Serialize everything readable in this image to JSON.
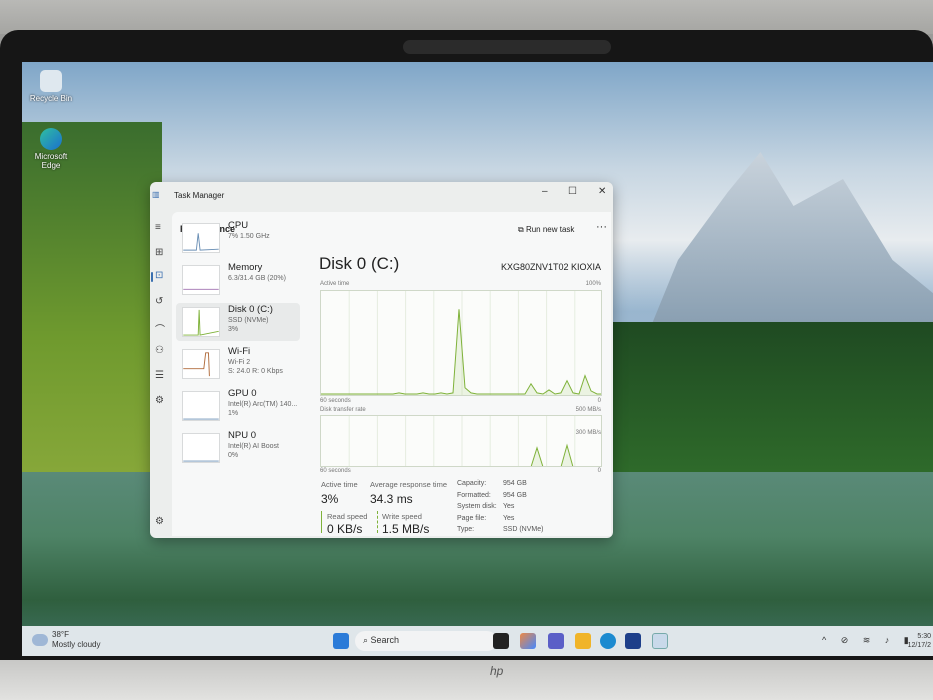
{
  "desktop": {
    "icons": [
      {
        "label": "Recycle Bin"
      },
      {
        "label": "Microsoft Edge"
      }
    ]
  },
  "window": {
    "title": "Task Manager",
    "minimize": "–",
    "maximize": "☐",
    "close": "✕"
  },
  "page": {
    "title": "Performance",
    "run_new_task": "Run new task",
    "more": "···"
  },
  "items": [
    {
      "name": "CPU",
      "sub1": "7% 1.50 GHz",
      "sub2": ""
    },
    {
      "name": "Memory",
      "sub1": "6.3/31.4 GB (20%)",
      "sub2": ""
    },
    {
      "name": "Disk 0 (C:)",
      "sub1": "SSD (NVMe)",
      "sub2": "3%"
    },
    {
      "name": "Wi-Fi",
      "sub1": "Wi-Fi 2",
      "sub2": "S: 24.0 R: 0 Kbps"
    },
    {
      "name": "GPU 0",
      "sub1": "Intel(R) Arc(TM) 140...",
      "sub2": "1%"
    },
    {
      "name": "NPU 0",
      "sub1": "Intel(R) AI Boost",
      "sub2": "0%"
    }
  ],
  "detail": {
    "title": "Disk 0 (C:)",
    "model": "KXG80ZNV1T02 KIOXIA",
    "graph1": {
      "label": "Active time",
      "max": "100%",
      "xlabel": "60 seconds",
      "min": "0",
      "points": [
        2,
        2,
        2,
        2,
        2,
        2,
        2,
        2,
        2,
        2,
        2,
        2,
        2,
        3,
        2,
        2,
        2,
        3,
        2,
        2,
        3,
        2,
        3,
        85,
        8,
        3,
        2,
        2,
        2,
        2,
        2,
        2,
        2,
        2,
        2,
        12,
        3,
        2,
        6,
        2,
        3,
        15,
        3,
        2,
        20,
        5,
        2,
        2
      ]
    },
    "graph2": {
      "label": "Disk transfer rate",
      "max": "500 MB/s",
      "mid": "300 MB/s",
      "xlabel": "60 seconds",
      "min": "0",
      "points": [
        0,
        0,
        0,
        0,
        0,
        0,
        0,
        0,
        0,
        0,
        0,
        0,
        0,
        0,
        0,
        0,
        0,
        0,
        0,
        0,
        0,
        0,
        0,
        0,
        0,
        0,
        0,
        0,
        0,
        0,
        0,
        0,
        0,
        0,
        0,
        0,
        40,
        0,
        0,
        0,
        0,
        45,
        0,
        0,
        0,
        0,
        0,
        0
      ]
    },
    "stats": {
      "active_time_label": "Active time",
      "active_time": "3%",
      "avg_resp_label": "Average response time",
      "avg_resp": "34.3 ms",
      "read_label": "Read speed",
      "read": "0 KB/s",
      "write_label": "Write speed",
      "write": "1.5 MB/s"
    },
    "props": [
      [
        "Capacity:",
        "954 GB"
      ],
      [
        "Formatted:",
        "954 GB"
      ],
      [
        "System disk:",
        "Yes"
      ],
      [
        "Page file:",
        "Yes"
      ],
      [
        "Type:",
        "SSD (NVMe)"
      ]
    ]
  },
  "taskbar": {
    "temp": "38°F",
    "weather": "Mostly cloudy",
    "search": "Search",
    "time": "5:30",
    "date": "12/17/2"
  },
  "colors": {
    "disk": "#7fb23a",
    "accent": "#3a6fb0"
  }
}
